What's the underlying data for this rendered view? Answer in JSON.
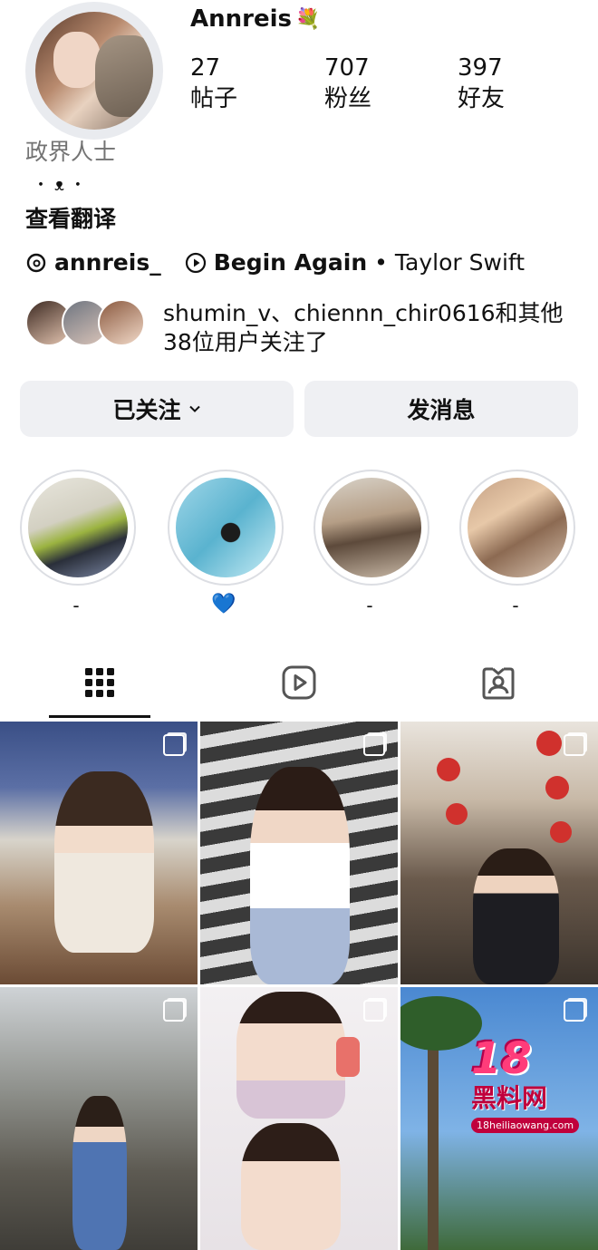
{
  "profile": {
    "username": "Annreis",
    "username_emoji": "💐",
    "category": "政界人士",
    "bio": "・ᴥ・",
    "translate_label": "查看翻译",
    "threads_handle": "annreis_",
    "music_title": "Begin Again",
    "music_separator": "•",
    "music_artist": "Taylor Swift"
  },
  "stats": [
    {
      "value": "27",
      "label": "帖子"
    },
    {
      "value": "707",
      "label": "粉丝"
    },
    {
      "value": "397",
      "label": "好友"
    }
  ],
  "followed_by_text": "shumin_v、chiennn_chir0616和其他38位用户关注了",
  "actions": {
    "follow_label": "已关注",
    "message_label": "发消息"
  },
  "highlights": [
    {
      "label": "-"
    },
    {
      "label": "💙"
    },
    {
      "label": "-"
    },
    {
      "label": "-"
    }
  ],
  "tabs": [
    "grid-icon",
    "reels-icon",
    "tagged-icon"
  ],
  "watermark": {
    "number": "18",
    "text": "黑料网",
    "url": "18heiliaowang.com"
  },
  "colors": {
    "button_bg": "#eff0f3",
    "secondary_text": "#737373",
    "ring": "#dcdee3"
  }
}
